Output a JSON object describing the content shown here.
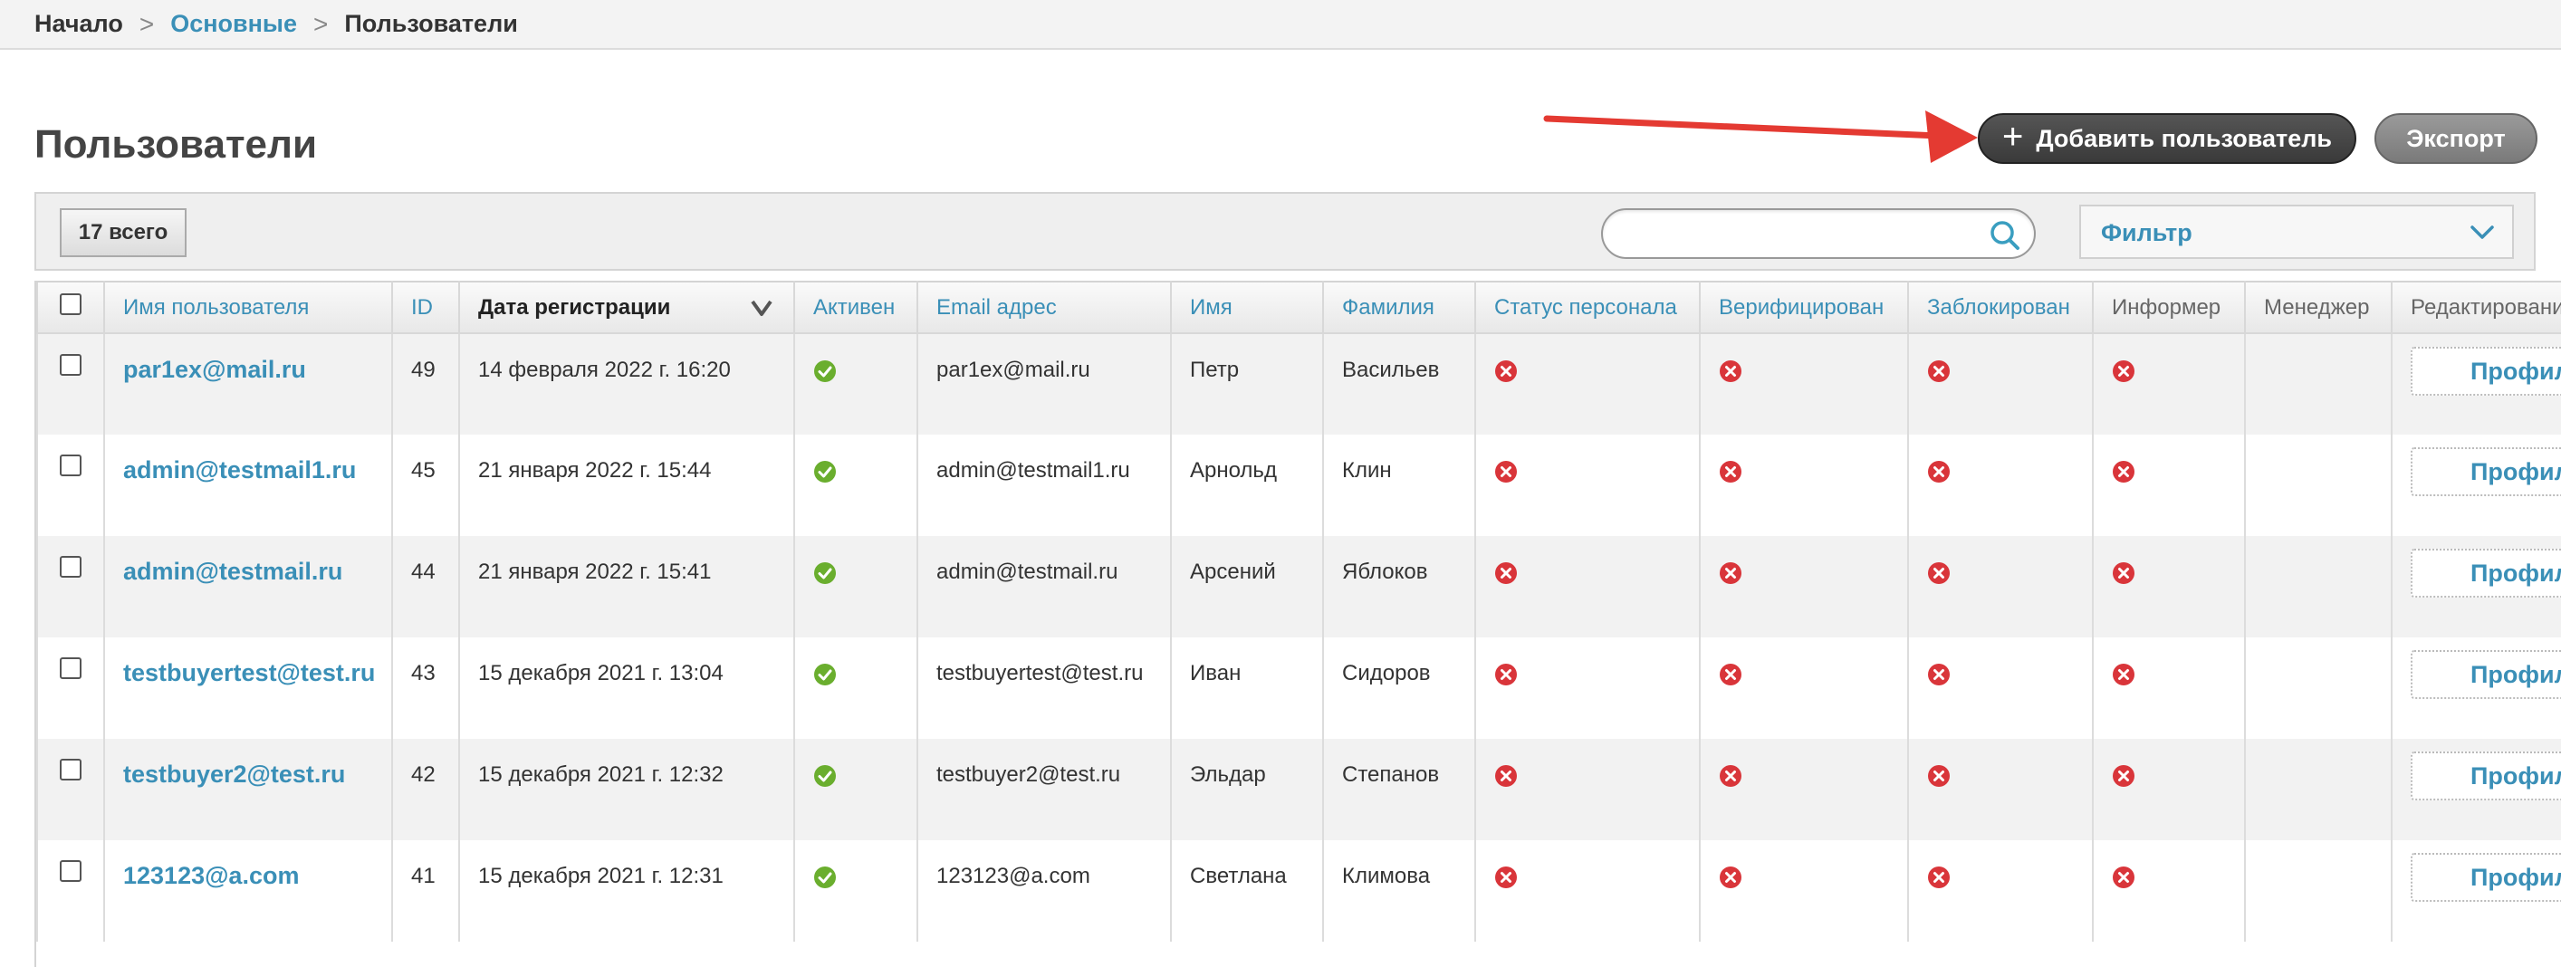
{
  "breadcrumb": {
    "home": "Начало",
    "section": "Основные",
    "current": "Пользователи",
    "separator": ">"
  },
  "page_title": "Пользователи",
  "actions": {
    "add_user": "Добавить пользователь",
    "export": "Экспорт"
  },
  "toolbar": {
    "total": "17 всего",
    "search_value": "",
    "filter_label": "Фильтр"
  },
  "colors": {
    "link": "#3a8fb7",
    "active_ok": "#6aae2e",
    "inactive": "#d9353a",
    "annotation_arrow": "#e43a32"
  },
  "table": {
    "headers": {
      "username": "Имя пользователя",
      "id": "ID",
      "reg_date": "Дата регистрации",
      "active": "Активен",
      "email": "Email адрес",
      "first_name": "Имя",
      "last_name": "Фамилия",
      "staff": "Статус персонала",
      "verified": "Верифицирован",
      "blocked": "Заблокирован",
      "informer": "Информер",
      "manager": "Менеджер",
      "edit": "Редактировани"
    },
    "edit_label": "Профил",
    "rows": [
      {
        "username": "par1ex@mail.ru",
        "id": "49",
        "reg_date": "14 февраля 2022 г. 16:20",
        "active": true,
        "email": "par1ex@mail.ru",
        "first_name": "Петр",
        "last_name": "Васильев",
        "staff": false,
        "verified": false,
        "blocked": false,
        "informer": false
      },
      {
        "username": "admin@testmail1.ru",
        "id": "45",
        "reg_date": "21 января 2022 г. 15:44",
        "active": true,
        "email": "admin@testmail1.ru",
        "first_name": "Арнольд",
        "last_name": "Клин",
        "staff": false,
        "verified": false,
        "blocked": false,
        "informer": false
      },
      {
        "username": "admin@testmail.ru",
        "id": "44",
        "reg_date": "21 января 2022 г. 15:41",
        "active": true,
        "email": "admin@testmail.ru",
        "first_name": "Арсений",
        "last_name": "Яблоков",
        "staff": false,
        "verified": false,
        "blocked": false,
        "informer": false
      },
      {
        "username": "testbuyertest@test.ru",
        "id": "43",
        "reg_date": "15 декабря 2021 г. 13:04",
        "active": true,
        "email": "testbuyertest@test.ru",
        "first_name": "Иван",
        "last_name": "Сидоров",
        "staff": false,
        "verified": false,
        "blocked": false,
        "informer": false
      },
      {
        "username": "testbuyer2@test.ru",
        "id": "42",
        "reg_date": "15 декабря 2021 г. 12:32",
        "active": true,
        "email": "testbuyer2@test.ru",
        "first_name": "Эльдар",
        "last_name": "Степанов",
        "staff": false,
        "verified": false,
        "blocked": false,
        "informer": false
      },
      {
        "username": "123123@a.com",
        "id": "41",
        "reg_date": "15 декабря 2021 г. 12:31",
        "active": true,
        "email": "123123@a.com",
        "first_name": "Светлана",
        "last_name": "Климова",
        "staff": false,
        "verified": false,
        "blocked": false,
        "informer": false
      }
    ]
  }
}
